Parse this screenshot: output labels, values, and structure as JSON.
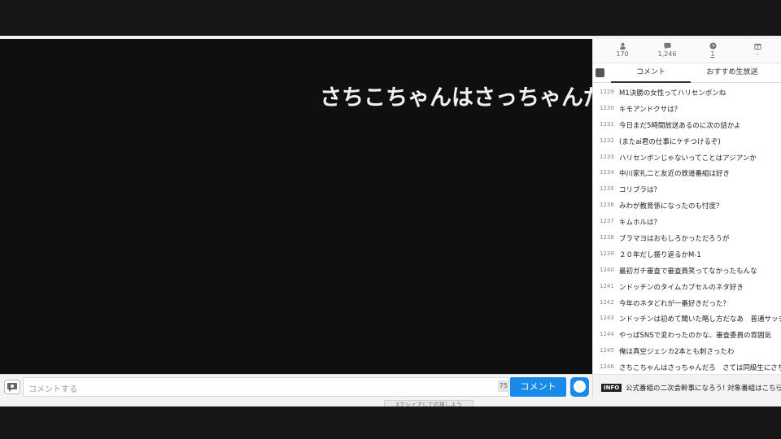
{
  "player": {
    "scrolling_comment": "さちこちゃんはさっちゃんだ"
  },
  "comment_bar": {
    "placeholder": "コメントする",
    "char_count": "75",
    "submit_label": "コメント"
  },
  "share": {
    "label": "Xでシェアして応援しよう"
  },
  "stats": {
    "viewers": "170",
    "comments": "1,246",
    "time": "1",
    "gift": "-"
  },
  "tabs": {
    "comment": "コメント",
    "recommend": "おすすめ生放送"
  },
  "comments": [
    {
      "no": "1229",
      "text": "M1決勝の女性ってハリセンボンね"
    },
    {
      "no": "1230",
      "text": "キモアンドクサは？"
    },
    {
      "no": "1231",
      "text": "今日まだ5時間放送あるのに次の話かよ"
    },
    {
      "no": "1232",
      "text": "(またai君の仕事にケチつけるぞ)"
    },
    {
      "no": "1233",
      "text": "ハリセンボンじゃないってことはアジアンか"
    },
    {
      "no": "1234",
      "text": "中川家礼二と友近の鉄道番組は好き"
    },
    {
      "no": "1235",
      "text": "コリブラは？"
    },
    {
      "no": "1236",
      "text": "みわが教育係になったのも忖度？"
    },
    {
      "no": "1237",
      "text": "キムホルは？"
    },
    {
      "no": "1238",
      "text": "ブラマヨはおもしろかっただろうが"
    },
    {
      "no": "1239",
      "text": "２０年だし振り返るかM-1"
    },
    {
      "no": "1240",
      "text": "最初ガチ審査で審査員笑ってなかったもんな"
    },
    {
      "no": "1241",
      "text": "ンドッチンのタイムカプセルのネタ好き"
    },
    {
      "no": "1242",
      "text": "今年のネタどれが一番好きだった？"
    },
    {
      "no": "1243",
      "text": "ンドッチンは初めて聞いた略し方だなあ　普通サッチンじゃ"
    },
    {
      "no": "1244",
      "text": "やっぱSNSで変わったのかな、審査委員の雰囲気"
    },
    {
      "no": "1245",
      "text": "俺は真空ジェシカ2本とも刺さったわ"
    },
    {
      "no": "1246",
      "text": "さちこちゃんはさっちゃんだろ　さては同級生にさちこちゃん"
    }
  ],
  "info": {
    "badge": "INFO",
    "text": "公式番組の二次会幹事になろう! 対象番組はこちら!!"
  },
  "colors": {
    "accent": "#1a8ae8",
    "background": "#161616"
  }
}
